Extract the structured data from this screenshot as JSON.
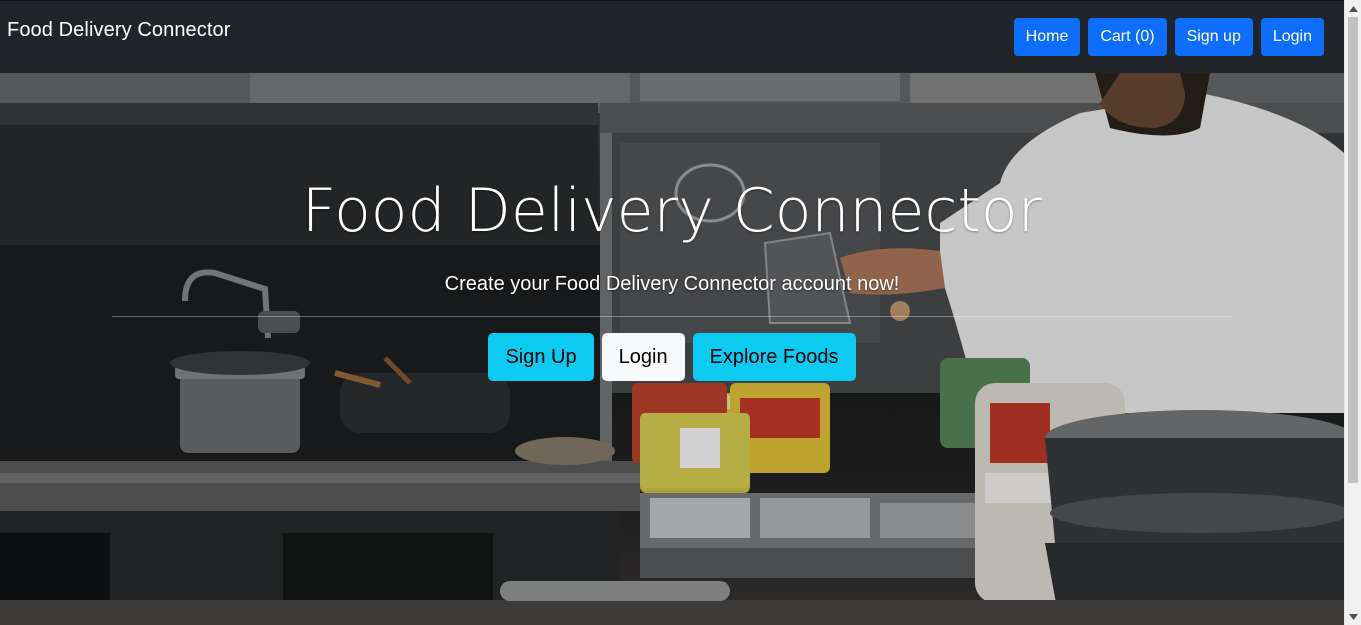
{
  "navbar": {
    "brand": "Food Delivery Connector",
    "buttons": [
      {
        "label": "Home"
      },
      {
        "label": "Cart (0)"
      },
      {
        "label": "Sign up"
      },
      {
        "label": "Login"
      }
    ]
  },
  "hero": {
    "title": "Food Delivery Connector",
    "subtitle": "Create your Food Delivery Connector account now!",
    "buttons": [
      {
        "label": "Sign Up",
        "style": "info"
      },
      {
        "label": "Login",
        "style": "light"
      },
      {
        "label": "Explore Foods",
        "style": "info"
      }
    ],
    "background_image": "commercial-kitchen-chef-cooking"
  },
  "colors": {
    "navbar_bg": "#212529",
    "primary": "#0d6efd",
    "info": "#0dcaf0",
    "light": "#f8f9fa"
  },
  "icons": {
    "scroll_up": "chevron-up-icon",
    "scroll_down": "chevron-down-icon"
  }
}
